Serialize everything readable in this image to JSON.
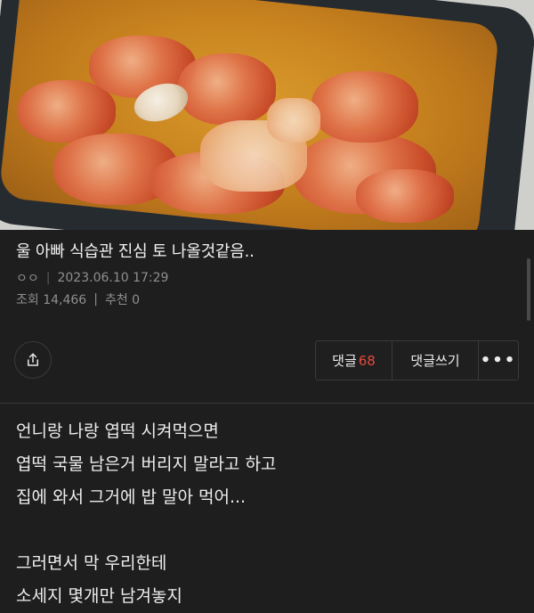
{
  "post": {
    "title": "울 아빠 식습관 진심 토 나올것같음..",
    "author": "ㅇㅇ",
    "date": "2023.06.10 17:29",
    "views_label": "조회",
    "views": "14,466",
    "recommend_label": "추천",
    "recommend": "0"
  },
  "actions": {
    "comments_label": "댓글",
    "comments_count": "68",
    "write_label": "댓글쓰기",
    "more_label": "•••"
  },
  "icons": {
    "share": "share-icon",
    "more": "more-dots-icon"
  },
  "body": {
    "lines": [
      "언니랑 나랑 엽떡 시켜먹으면",
      "엽떡 국물 남은거 버리지 말라고 하고",
      "집에 와서 그거에 밥 말아 먹어...",
      "",
      "그러면서 막 우리한테",
      "소세지 몇개만 남겨놓지"
    ]
  },
  "colors": {
    "background": "#1e1e1e",
    "accent_count": "#e84a3a",
    "meta_text": "#8f8f8f"
  }
}
